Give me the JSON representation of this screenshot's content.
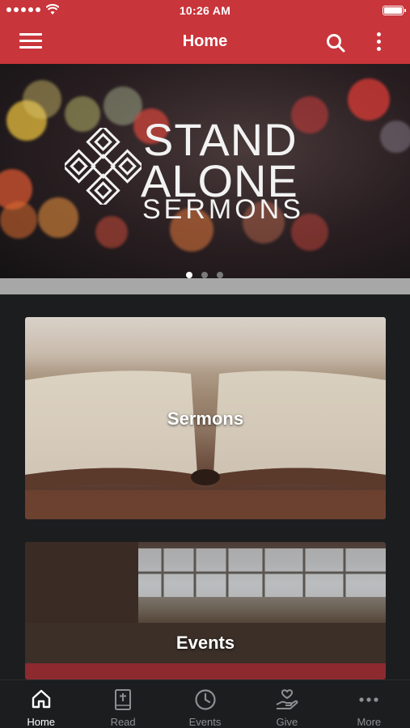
{
  "status_bar": {
    "time": "10:26 AM"
  },
  "nav": {
    "title": "Home",
    "icons": [
      "menu-icon",
      "search-icon",
      "more-vertical-icon"
    ]
  },
  "hero": {
    "line1": "STAND",
    "line2": "ALONE",
    "line3": "SERMONS",
    "slides": 3,
    "active_slide": 1
  },
  "cards": [
    {
      "label": "Sermons"
    },
    {
      "label": "Events"
    }
  ],
  "tabs": [
    {
      "label": "Home",
      "icon": "home-icon",
      "active": true
    },
    {
      "label": "Read",
      "icon": "bible-icon",
      "active": false
    },
    {
      "label": "Events",
      "icon": "clock-icon",
      "active": false
    },
    {
      "label": "Give",
      "icon": "give-hand-heart-icon",
      "active": false
    },
    {
      "label": "More",
      "icon": "more-horizontal-icon",
      "active": false
    }
  ],
  "colors": {
    "brand_red": "#c8353b",
    "background": "#1c1d1f",
    "tab_inactive": "#8e8f92",
    "tab_active": "#ffffff"
  }
}
